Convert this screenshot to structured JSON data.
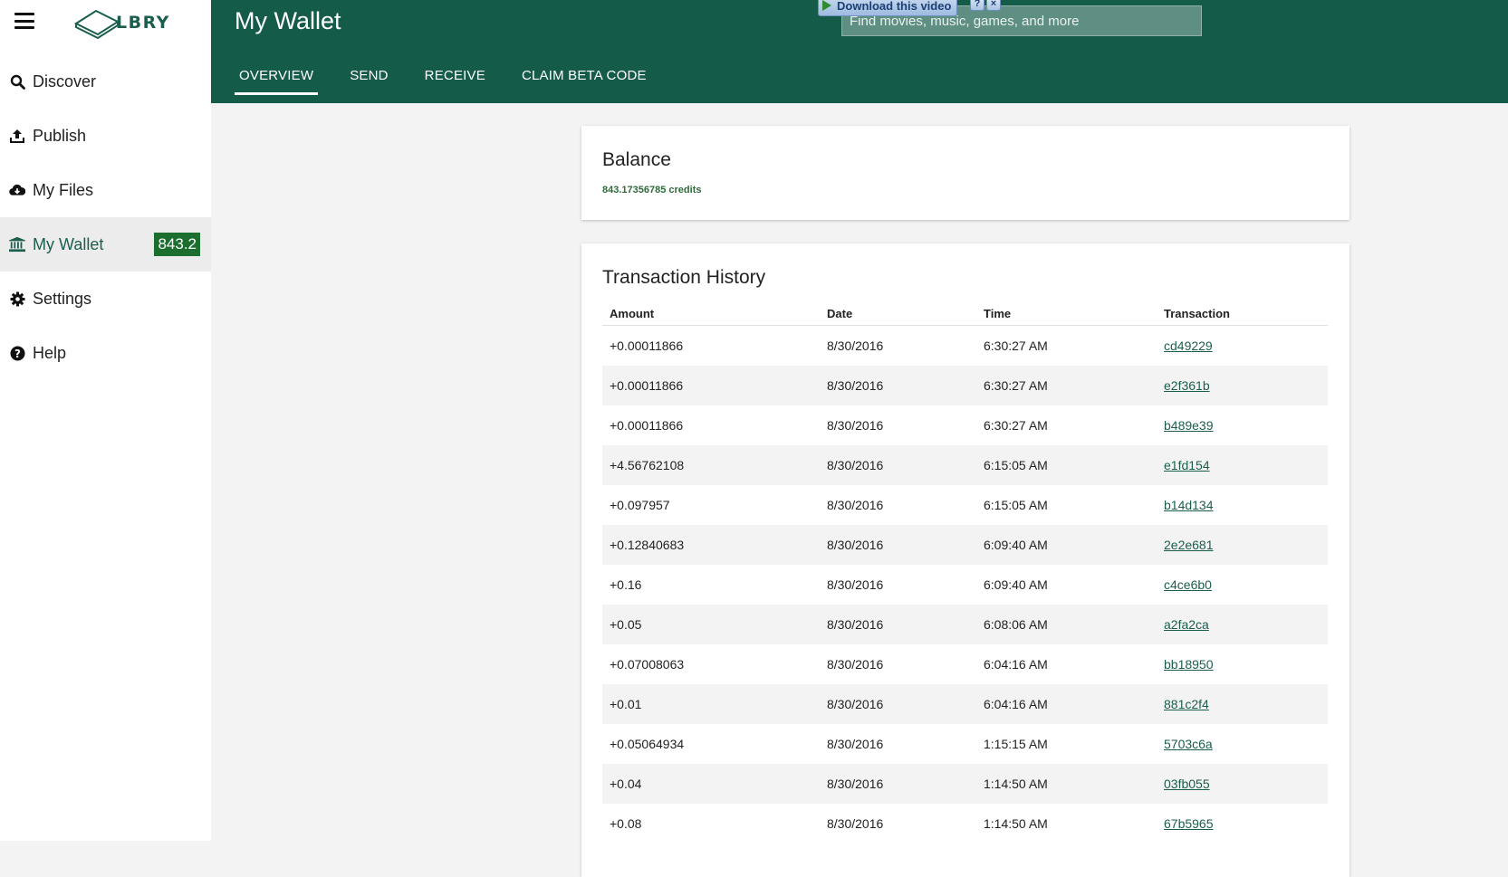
{
  "sidebar": {
    "logo_text": "LBRY",
    "items": [
      {
        "label": "Discover",
        "icon": "search-icon"
      },
      {
        "label": "Publish",
        "icon": "upload-icon"
      },
      {
        "label": "My Files",
        "icon": "cloud-download-icon"
      },
      {
        "label": "My Wallet",
        "icon": "bank-icon",
        "badge": "843.2"
      },
      {
        "label": "Settings",
        "icon": "gear-icon"
      },
      {
        "label": "Help",
        "icon": "question-icon"
      }
    ]
  },
  "header": {
    "title": "My Wallet",
    "search_placeholder": "Find movies, music, games, and more",
    "download_banner": "Download this video",
    "tabs": [
      "OVERVIEW",
      "SEND",
      "RECEIVE",
      "CLAIM BETA CODE"
    ]
  },
  "balance": {
    "title": "Balance",
    "value": "843.17356785 credits"
  },
  "history": {
    "title": "Transaction History",
    "columns": [
      "Amount",
      "Date",
      "Time",
      "Transaction"
    ],
    "rows": [
      [
        "+0.00011866",
        "8/30/2016",
        "6:30:27 AM",
        "cd49229"
      ],
      [
        "+0.00011866",
        "8/30/2016",
        "6:30:27 AM",
        "e2f361b"
      ],
      [
        "+0.00011866",
        "8/30/2016",
        "6:30:27 AM",
        "b489e39"
      ],
      [
        "+4.56762108",
        "8/30/2016",
        "6:15:05 AM",
        "e1fd154"
      ],
      [
        "+0.097957",
        "8/30/2016",
        "6:15:05 AM",
        "b14d134"
      ],
      [
        "+0.12840683",
        "8/30/2016",
        "6:09:40 AM",
        "2e2e681"
      ],
      [
        "+0.16",
        "8/30/2016",
        "6:09:40 AM",
        "c4ce6b0"
      ],
      [
        "+0.05",
        "8/30/2016",
        "6:08:06 AM",
        "a2fa2ca"
      ],
      [
        "+0.07008063",
        "8/30/2016",
        "6:04:16 AM",
        "bb18950"
      ],
      [
        "+0.01",
        "8/30/2016",
        "6:04:16 AM",
        "881c2f4"
      ],
      [
        "+0.05064934",
        "8/30/2016",
        "1:15:15 AM",
        "5703c6a"
      ],
      [
        "+0.04",
        "8/30/2016",
        "1:14:50 AM",
        "03fb055"
      ],
      [
        "+0.08",
        "8/30/2016",
        "1:14:50 AM",
        "67b5965"
      ]
    ]
  },
  "colors": {
    "brand": "#155b4a",
    "badge": "#1b6e2e",
    "link": "#1b5e4e"
  }
}
